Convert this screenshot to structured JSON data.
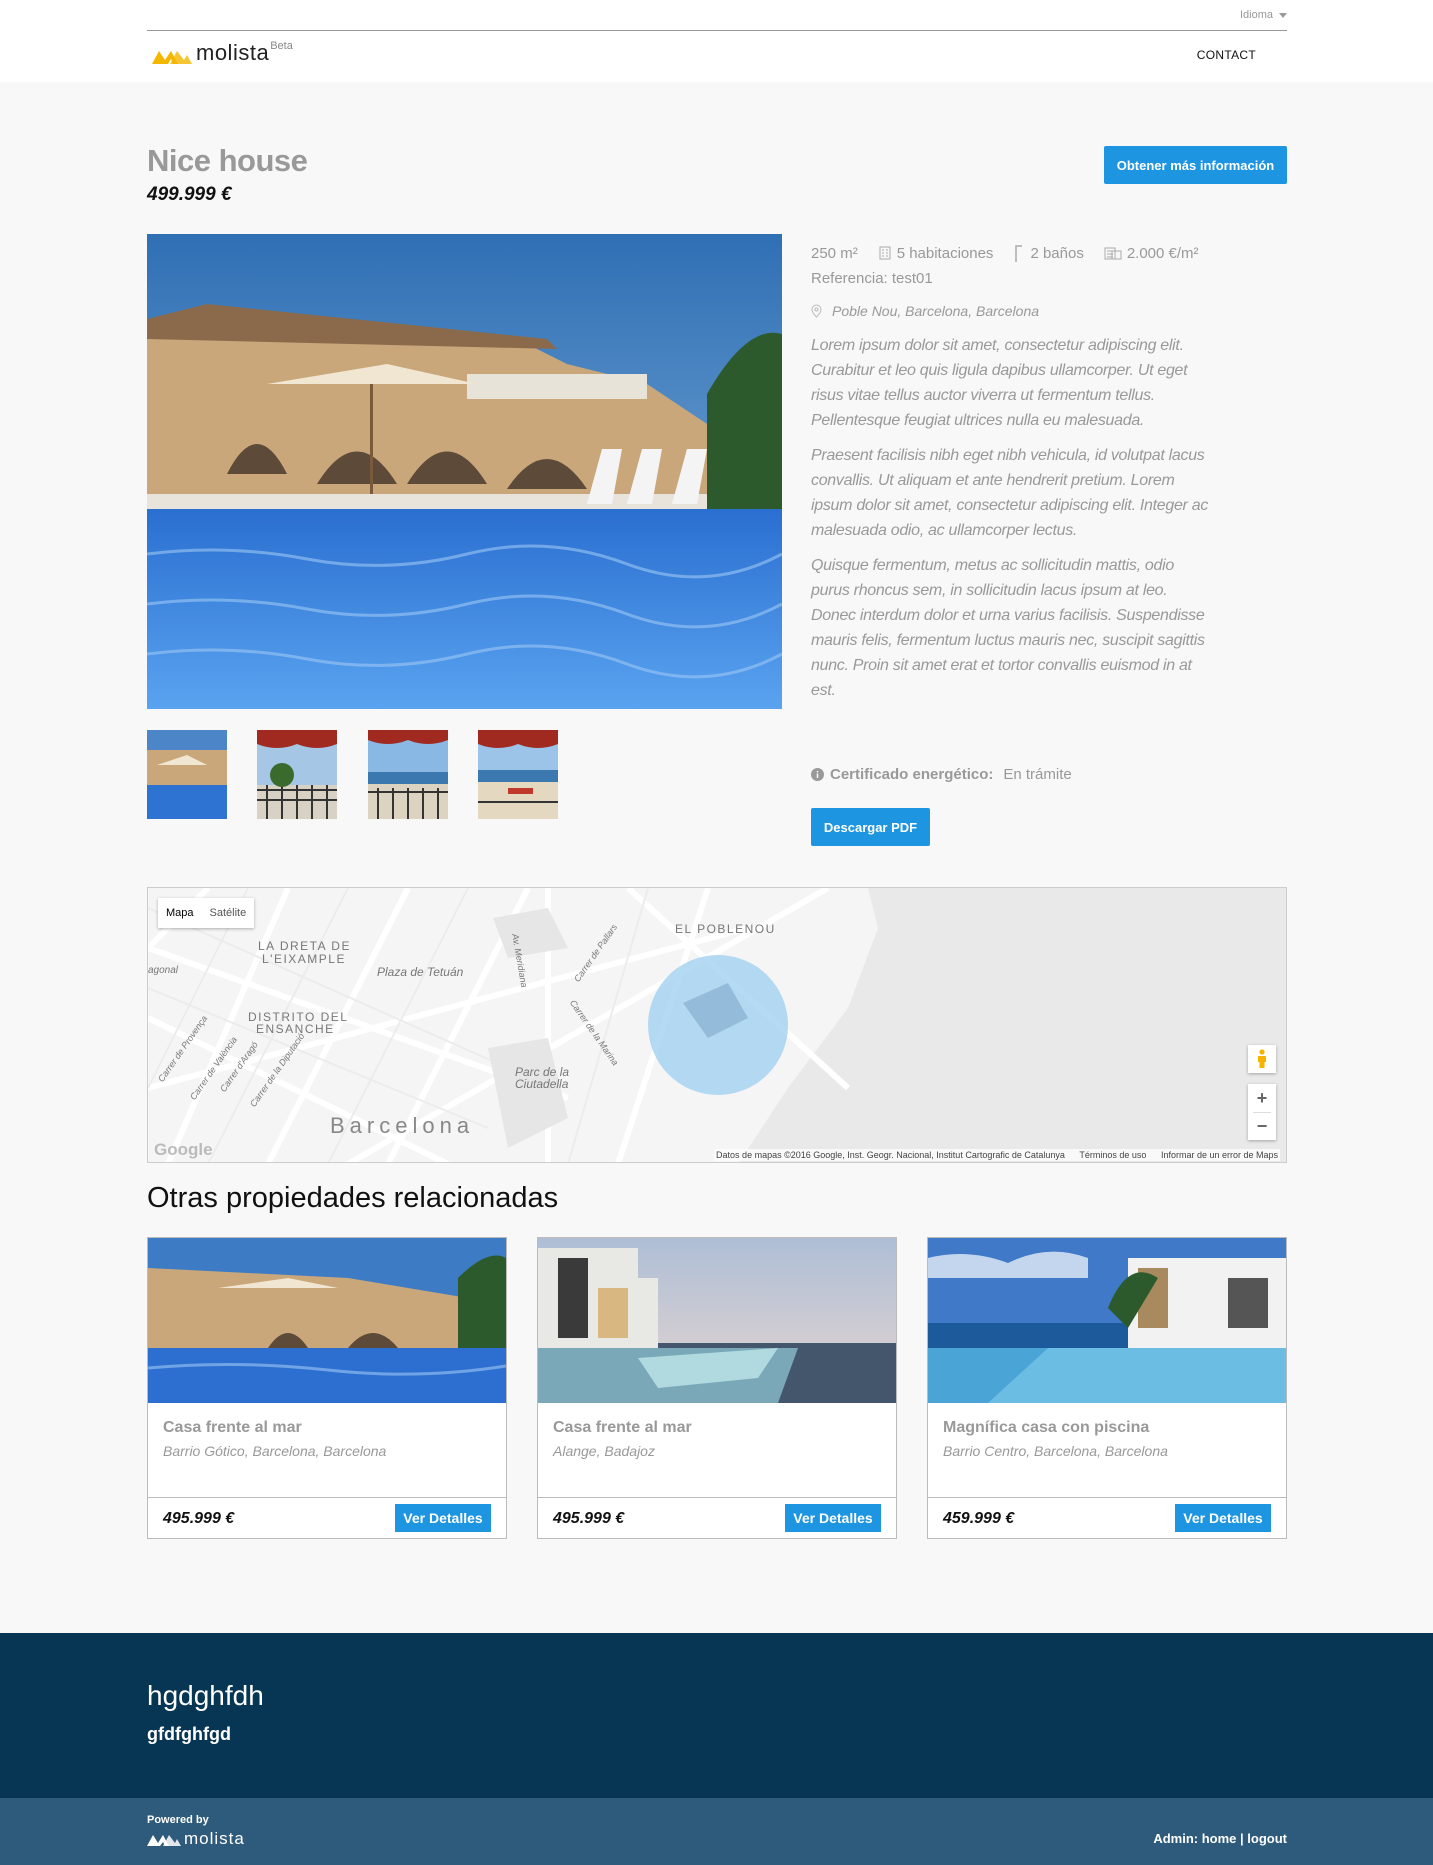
{
  "header": {
    "language_label": "Idioma",
    "brand": "molista",
    "brand_badge": "Beta",
    "nav_contact": "CONTACT"
  },
  "property": {
    "title": "Nice house",
    "price": "499.999 €",
    "info_button": "Obtener más información",
    "specs": {
      "area": "250 m²",
      "rooms": "5 habitaciones",
      "baths": "2 baños",
      "price_per_m2": "2.000 €/m²"
    },
    "reference": "Referencia: test01",
    "location": "Poble Nou, Barcelona, Barcelona",
    "description": [
      "Lorem ipsum dolor sit amet, consectetur adipiscing elit. Curabitur et leo quis ligula dapibus ullamcorper. Ut eget risus vitae tellus auctor viverra ut fermentum tellus. Pellentesque feugiat ultrices nulla eu malesuada.",
      "Praesent facilisis nibh eget nibh vehicula, id volutpat lacus convallis. Ut aliquam et ante hendrerit pretium. Lorem ipsum dolor sit amet, consectetur adipiscing elit. Integer ac malesuada odio, ac ullamcorper lectus.",
      "Quisque fermentum, metus ac sollicitudin mattis, odio purus rhoncus sem, in sollicitudin lacus ipsum at leo. Donec interdum dolor et urna varius facilisis. Suspendisse mauris felis, fermentum luctus mauris nec, suscipit sagittis nunc. Proin sit amet erat et tortor convallis euismod in at est."
    ],
    "energy_label": "Certificado energético:",
    "energy_value": "En trámite",
    "pdf_button": "Descargar PDF"
  },
  "map": {
    "type_map": "Mapa",
    "type_satellite": "Satélite",
    "labels": {
      "dreta": "LA DRETA DE",
      "eixample": "L'EIXAMPLE",
      "poblenou": "EL POBLENOU",
      "tetuan": "Plaza de Tetuán",
      "distrito": "DISTRITO DEL",
      "ensanche": "ENSANCHE",
      "parc1": "Parc de la",
      "parc2": "Ciutadella",
      "city": "Barcelona",
      "meridiana": "Av. Meridiana",
      "pallars": "Carrer de Pallars",
      "marina": "Carrer de la Marina",
      "provenca": "Carrer de Provença",
      "valencia": "Carrer de València",
      "arago": "Carrer d'Aragó",
      "diputacio": "Carrer de la Diputació",
      "diagonal": "agonal"
    },
    "zoom_in": "+",
    "zoom_out": "−",
    "attribution": "Datos de mapas ©2016 Google, Inst. Geogr. Nacional, Institut Cartografic de Catalunya",
    "terms": "Términos de uso",
    "report": "Informar de un error de Maps",
    "google": "Google"
  },
  "related": {
    "heading": "Otras propiedades relacionadas",
    "items": [
      {
        "title": "Casa frente al mar",
        "location": "Barrio Gótico, Barcelona, Barcelona",
        "price": "495.999 €",
        "button": "Ver Detalles"
      },
      {
        "title": "Casa frente al mar",
        "location": "Alange, Badajoz",
        "price": "495.999 €",
        "button": "Ver Detalles"
      },
      {
        "title": "Magnífica casa con piscina",
        "location": "Barrio Centro, Barcelona, Barcelona",
        "price": "459.999 €",
        "button": "Ver Detalles"
      }
    ]
  },
  "footer": {
    "title": "hgdghfdh",
    "subtitle": "gfdfghfgd",
    "powered_by": "Powered by",
    "brand": "molista",
    "admin_prefix": "Admin:",
    "admin_home": "home",
    "admin_sep": "|",
    "admin_logout": "logout"
  },
  "colors": {
    "accent": "#1e95e0",
    "footer_dark": "#073655",
    "footer_light": "#2e5b7b",
    "logo_yellow": "#f3b700"
  }
}
